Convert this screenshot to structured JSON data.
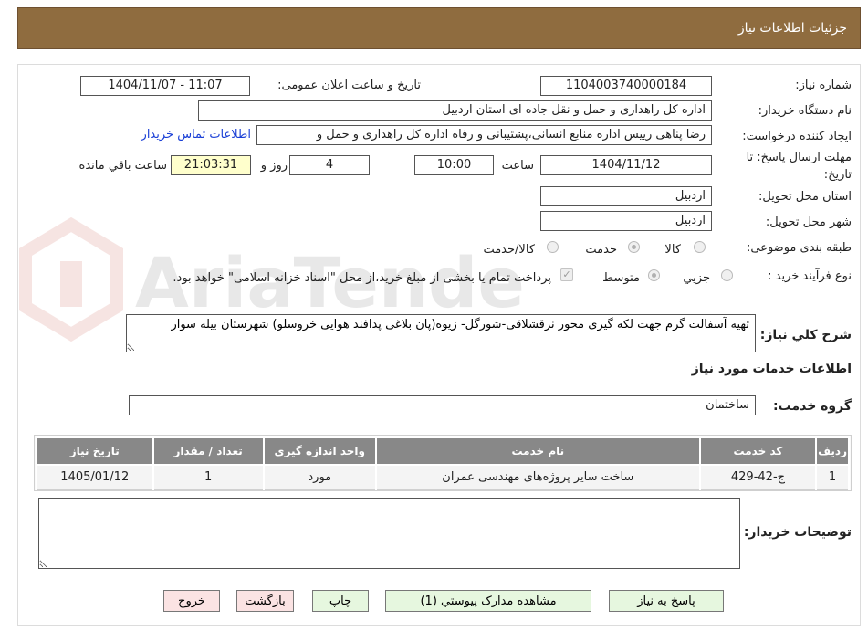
{
  "header": {
    "title": "جزئیات اطلاعات نیاز"
  },
  "fields": {
    "need_number_label": "شماره نیاز:",
    "need_number": "1104003740000184",
    "announce_label": "تاریخ و ساعت اعلان عمومی:",
    "announce_value": "1404/11/07 - 11:07",
    "buyer_org_label": "نام دستگاه خریدار:",
    "buyer_org": "اداره کل راهداری و حمل و نقل جاده ای استان اردبیل",
    "requester_label": "ایجاد کننده درخواست:",
    "requester": "رضا پناهی رییس اداره منابع انسانی،پشتیبانی و رفاه اداره کل راهداری و حمل و",
    "contact_link": "اطلاعات تماس خریدار",
    "deadline_label_1": "مهلت ارسال پاسخ: تا",
    "deadline_label_2": "تاریخ:",
    "deadline_date": "1404/11/12",
    "time_label": "ساعت",
    "deadline_time": "10:00",
    "days_value": "4",
    "days_label": "روز و",
    "remaining_time": "21:03:31",
    "remaining_label": "ساعت باقي مانده",
    "province_label": "استان محل تحویل:",
    "province": "اردبیل",
    "city_label": "شهر محل تحویل:",
    "city": "اردبیل",
    "category_label": "طبقه بندی موضوعی:",
    "category_options": [
      "کالا",
      "خدمت",
      "کالا/خدمت"
    ],
    "category_selected": "خدمت",
    "process_label": "نوع فرآیند خرید :",
    "process_options": [
      "جزيي",
      "متوسط"
    ],
    "process_selected": "متوسط",
    "payment_note": "پرداخت تمام یا بخشی از مبلغ خرید،از محل \"اسناد خزانه اسلامی\" خواهد بود.",
    "description_label": "شرح کلي نياز:",
    "description": "تهیه آسفالت گرم جهت لکه گیری محور نرقشلاقی-شورگل- زیوه(پان بلاغی پدافند هوایی خروسلو) شهرستان بیله سوار",
    "services_heading": "اطلاعات خدمات مورد نیاز",
    "service_group_label": "گروه خدمت:",
    "service_group": "ساختمان",
    "buyer_notes_label": "توضیحات خریدار:",
    "buyer_notes": ""
  },
  "table": {
    "headers": [
      "رديف",
      "کد خدمت",
      "نام خدمت",
      "واحد اندازه گیری",
      "تعداد / مقدار",
      "تاریخ نیاز"
    ],
    "rows": [
      [
        "1",
        "ج-42-429",
        "ساخت سایر پروژه‌های مهندسی عمران",
        "مورد",
        "1",
        "1405/01/12"
      ]
    ]
  },
  "buttons": {
    "reply": "پاسخ به نیاز",
    "attachments": "مشاهده مدارک پیوستي (1)",
    "print": "چاپ",
    "back": "بازگشت",
    "exit": "خروج"
  },
  "watermark_text": "AriaTender.neT",
  "colors": {
    "header_bg": "#8f6c3f",
    "link": "#1a3fd6",
    "button_green": "#e6f7df",
    "button_red": "#fbe3e3",
    "table_header": "#888888",
    "highlight": "#ffffcc"
  }
}
